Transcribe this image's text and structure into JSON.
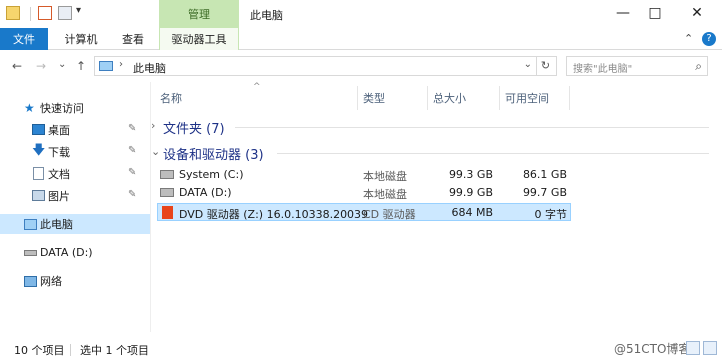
{
  "titlebar": {
    "context_tab_group": "管理",
    "window_title": "此电脑",
    "minimize": "—",
    "maximize": "□",
    "close": "✕",
    "qa_dropdown": "▾"
  },
  "ribbon": {
    "tabs": [
      {
        "label": "文件"
      },
      {
        "label": "计算机"
      },
      {
        "label": "查看"
      },
      {
        "label": "驱动器工具"
      }
    ],
    "collapse": "⌃",
    "help": "?"
  },
  "address": {
    "back": "←",
    "forward": "→",
    "recent": "⌄",
    "up": "↑",
    "separator": "›",
    "path": "此电脑",
    "dropdown": "⌄",
    "refresh": "↻",
    "search_placeholder": "搜索\"此电脑\"",
    "search_icon": "⌕"
  },
  "sidebar": {
    "items": [
      {
        "label": "快速访问",
        "icon": "star-icon"
      },
      {
        "label": "桌面",
        "icon": "desktop-icon",
        "pinned": true
      },
      {
        "label": "下载",
        "icon": "download-icon",
        "pinned": true
      },
      {
        "label": "文档",
        "icon": "document-icon",
        "pinned": true
      },
      {
        "label": "图片",
        "icon": "picture-icon",
        "pinned": true
      },
      {
        "label": "此电脑",
        "icon": "pc-icon",
        "selected": true
      },
      {
        "label": "DATA (D:)",
        "icon": "drive-icon"
      },
      {
        "label": "网络",
        "icon": "network-icon"
      }
    ],
    "pin_glyph": "📌"
  },
  "columns": {
    "name": "名称",
    "type": "类型",
    "total": "总大小",
    "free": "可用空间",
    "sort_caret": "^"
  },
  "groups": [
    {
      "label": "文件夹 (7)",
      "chevron": "›",
      "expanded": false
    },
    {
      "label": "设备和驱动器 (3)",
      "chevron": "⌄",
      "expanded": true
    }
  ],
  "drives": [
    {
      "name": "System (C:)",
      "type": "本地磁盘",
      "total": "99.3 GB",
      "free": "86.1 GB",
      "icon": "drive-icon",
      "selected": false
    },
    {
      "name": "DATA (D:)",
      "type": "本地磁盘",
      "total": "99.9 GB",
      "free": "99.7 GB",
      "icon": "drive-icon",
      "selected": false
    },
    {
      "name": "DVD 驱动器 (Z:) 16.0.10338.20039",
      "type": "CD 驱动器",
      "total": "684 MB",
      "free": "0 字节",
      "icon": "office-dvd-icon",
      "selected": true
    }
  ],
  "status": {
    "item_count": "10 个项目",
    "selection": "选中 1 个项目",
    "watermark": "@51CTO博客"
  },
  "colors": {
    "file_tab": "#1979ca",
    "context_tab": "#c7e6b3",
    "selection": "#cce8ff",
    "group_text": "#1e3287"
  }
}
